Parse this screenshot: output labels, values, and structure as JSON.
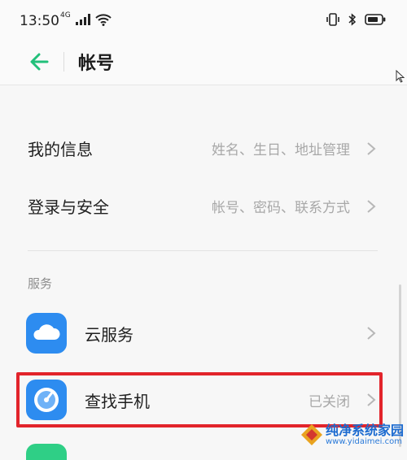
{
  "status_bar": {
    "time": "13:50",
    "network": "4G",
    "icons_left": [
      "signal-icon",
      "wifi-icon"
    ],
    "icons_right": [
      "vibrate-icon",
      "bluetooth-icon",
      "battery-icon"
    ]
  },
  "header": {
    "title": "帐号",
    "back_icon": "back-arrow-icon"
  },
  "rows": [
    {
      "label": "我的信息",
      "value": "姓名、生日、地址管理"
    },
    {
      "label": "登录与安全",
      "value": "帐号、密码、联系方式"
    }
  ],
  "services": {
    "section_label": "服务",
    "items": [
      {
        "label": "云服务",
        "value": "",
        "icon": "cloud-icon",
        "icon_color": "#2d8cf0"
      },
      {
        "label": "查找手机",
        "value": "已关闭",
        "icon": "find-phone-icon",
        "icon_color": "#2d8cf0"
      }
    ]
  },
  "watermark": {
    "text": "纯净系统家园",
    "url": "www.yidaimei.com"
  },
  "colors": {
    "accent": "#22c07a",
    "highlight": "#e2242b",
    "secondary_text": "#a8a8a8"
  }
}
